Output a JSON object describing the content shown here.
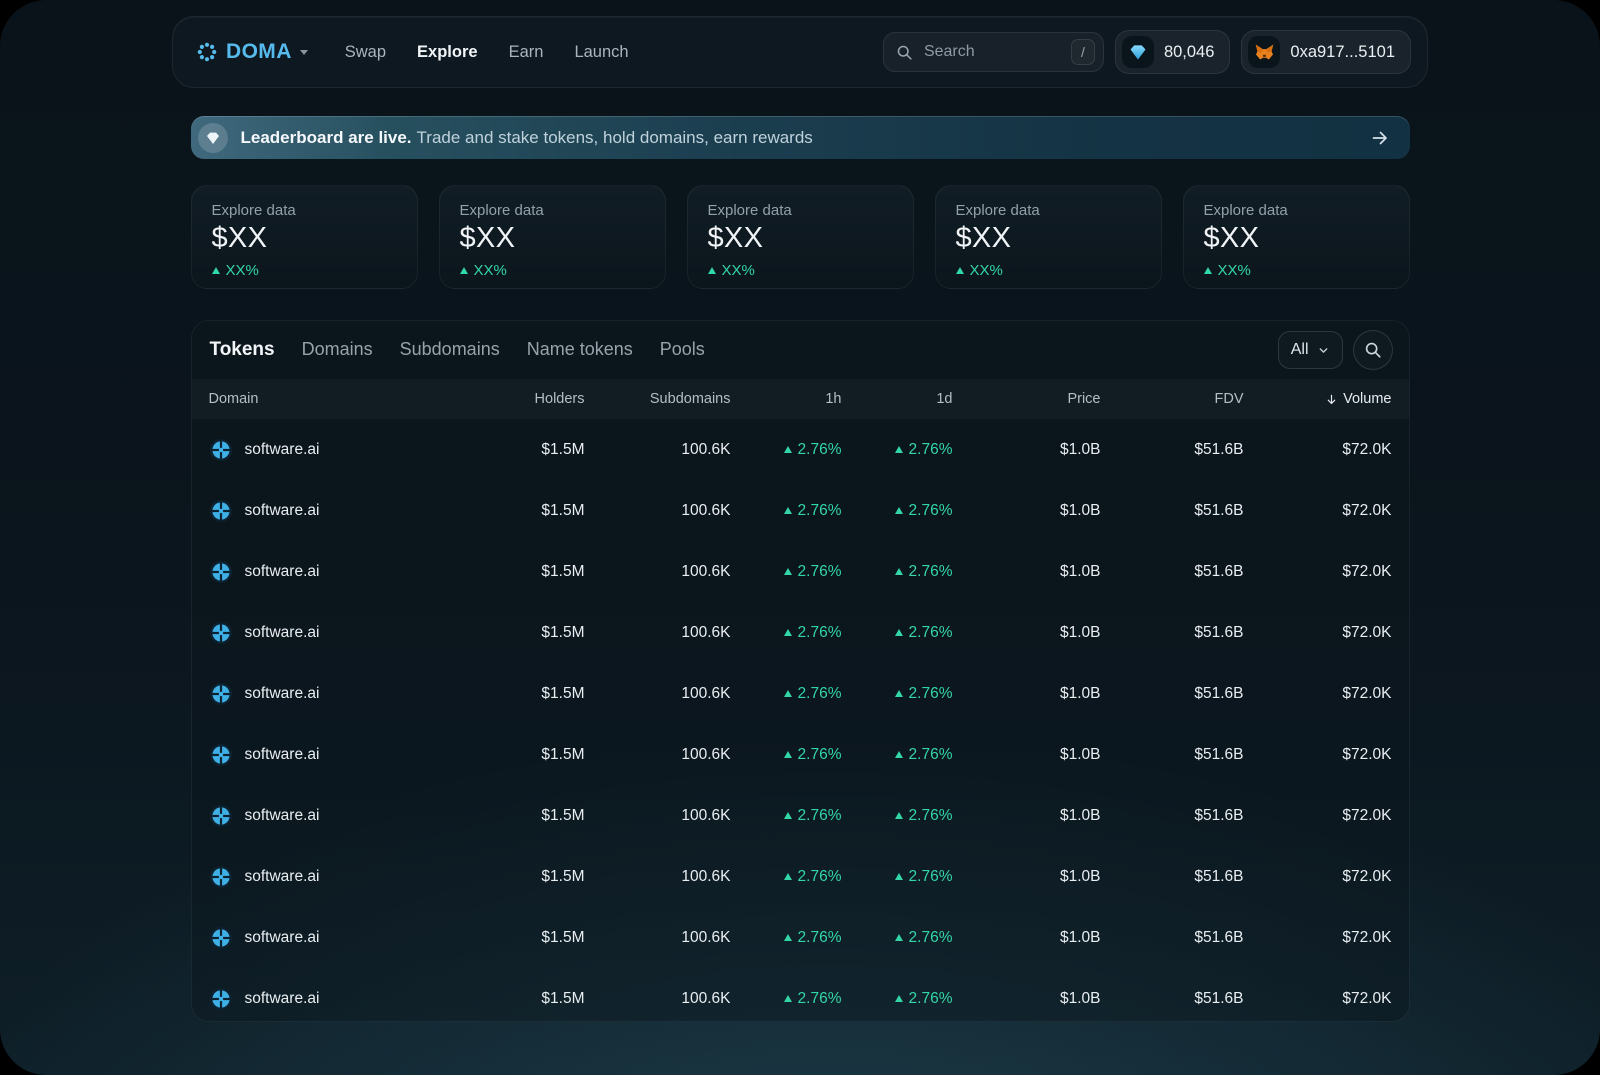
{
  "colors": {
    "accent_blue": "#56bbec",
    "positive_green": "#33d6a6",
    "fox_orange": "#e8821e",
    "banner_teal": "#27505f"
  },
  "nav": {
    "logo": "DOMA",
    "items": [
      {
        "label": "Swap",
        "active": false
      },
      {
        "label": "Explore",
        "active": true
      },
      {
        "label": "Earn",
        "active": false
      },
      {
        "label": "Launch",
        "active": false
      }
    ],
    "search": {
      "placeholder": "Search",
      "shortcut": "/"
    },
    "balance": "80,046",
    "wallet": "0xa917...5101"
  },
  "banner": {
    "title": "Leaderboard are live.",
    "subtitle": "Trade and stake tokens, hold domains, earn rewards"
  },
  "stat_cards": [
    {
      "label": "Explore data",
      "value": "$XX",
      "change": "XX%"
    },
    {
      "label": "Explore data",
      "value": "$XX",
      "change": "XX%"
    },
    {
      "label": "Explore data",
      "value": "$XX",
      "change": "XX%"
    },
    {
      "label": "Explore data",
      "value": "$XX",
      "change": "XX%"
    },
    {
      "label": "Explore data",
      "value": "$XX",
      "change": "XX%"
    }
  ],
  "explorer": {
    "tabs": [
      {
        "label": "Tokens",
        "active": true
      },
      {
        "label": "Domains",
        "active": false
      },
      {
        "label": "Subdomains",
        "active": false
      },
      {
        "label": "Name tokens",
        "active": false
      },
      {
        "label": "Pools",
        "active": false
      }
    ],
    "filter_value": "All",
    "table": {
      "columns": [
        {
          "label": "Domain",
          "align": "left",
          "sorted": false
        },
        {
          "label": "Holders",
          "align": "right",
          "sorted": false
        },
        {
          "label": "Subdomains",
          "align": "right",
          "sorted": false
        },
        {
          "label": "1h",
          "align": "right",
          "sorted": false
        },
        {
          "label": "1d",
          "align": "right",
          "sorted": false
        },
        {
          "label": "Price",
          "align": "right",
          "sorted": false
        },
        {
          "label": "FDV",
          "align": "right",
          "sorted": false
        },
        {
          "label": "Volume",
          "align": "right",
          "sorted": true
        }
      ],
      "rows": [
        {
          "domain": "software.ai",
          "holders": "$1.5M",
          "subdomains": "100.6K",
          "change_1h": "2.76%",
          "change_1d": "2.76%",
          "price": "$1.0B",
          "fdv": "$51.6B",
          "volume": "$72.0K"
        },
        {
          "domain": "software.ai",
          "holders": "$1.5M",
          "subdomains": "100.6K",
          "change_1h": "2.76%",
          "change_1d": "2.76%",
          "price": "$1.0B",
          "fdv": "$51.6B",
          "volume": "$72.0K"
        },
        {
          "domain": "software.ai",
          "holders": "$1.5M",
          "subdomains": "100.6K",
          "change_1h": "2.76%",
          "change_1d": "2.76%",
          "price": "$1.0B",
          "fdv": "$51.6B",
          "volume": "$72.0K"
        },
        {
          "domain": "software.ai",
          "holders": "$1.5M",
          "subdomains": "100.6K",
          "change_1h": "2.76%",
          "change_1d": "2.76%",
          "price": "$1.0B",
          "fdv": "$51.6B",
          "volume": "$72.0K"
        },
        {
          "domain": "software.ai",
          "holders": "$1.5M",
          "subdomains": "100.6K",
          "change_1h": "2.76%",
          "change_1d": "2.76%",
          "price": "$1.0B",
          "fdv": "$51.6B",
          "volume": "$72.0K"
        },
        {
          "domain": "software.ai",
          "holders": "$1.5M",
          "subdomains": "100.6K",
          "change_1h": "2.76%",
          "change_1d": "2.76%",
          "price": "$1.0B",
          "fdv": "$51.6B",
          "volume": "$72.0K"
        },
        {
          "domain": "software.ai",
          "holders": "$1.5M",
          "subdomains": "100.6K",
          "change_1h": "2.76%",
          "change_1d": "2.76%",
          "price": "$1.0B",
          "fdv": "$51.6B",
          "volume": "$72.0K"
        },
        {
          "domain": "software.ai",
          "holders": "$1.5M",
          "subdomains": "100.6K",
          "change_1h": "2.76%",
          "change_1d": "2.76%",
          "price": "$1.0B",
          "fdv": "$51.6B",
          "volume": "$72.0K"
        },
        {
          "domain": "software.ai",
          "holders": "$1.5M",
          "subdomains": "100.6K",
          "change_1h": "2.76%",
          "change_1d": "2.76%",
          "price": "$1.0B",
          "fdv": "$51.6B",
          "volume": "$72.0K"
        },
        {
          "domain": "software.ai",
          "holders": "$1.5M",
          "subdomains": "100.6K",
          "change_1h": "2.76%",
          "change_1d": "2.76%",
          "price": "$1.0B",
          "fdv": "$51.6B",
          "volume": "$72.0K"
        }
      ]
    }
  }
}
